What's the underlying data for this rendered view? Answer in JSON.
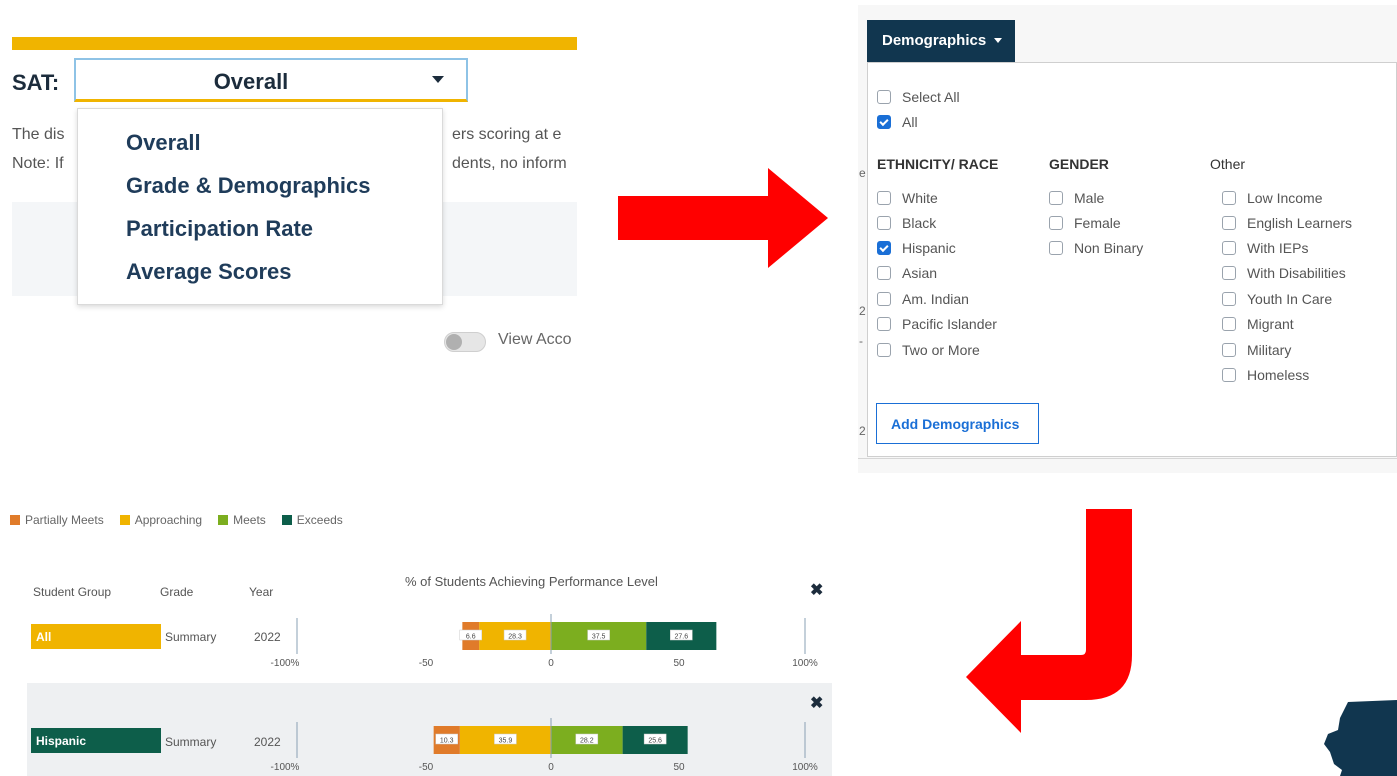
{
  "sat": {
    "label": "SAT:",
    "selected": "Overall",
    "description_start": "The dis",
    "description_end": "ers scoring at e",
    "note_start": "Note: If",
    "note_end": "dents, no inform",
    "menu_items": [
      "Overall",
      "Grade & Demographics",
      "Participation Rate",
      "Average Scores"
    ],
    "toggle_label": "View Acco"
  },
  "demographics": {
    "button_label": "Demographics",
    "select_all": {
      "label": "Select All",
      "checked": false
    },
    "all": {
      "label": "All",
      "checked": true
    },
    "columns": [
      {
        "heading": "ETHNICITY/ RACE",
        "items": [
          {
            "label": "White",
            "checked": false
          },
          {
            "label": "Black",
            "checked": false
          },
          {
            "label": "Hispanic",
            "checked": true
          },
          {
            "label": "Asian",
            "checked": false
          },
          {
            "label": "Am. Indian",
            "checked": false
          },
          {
            "label": "Pacific Islander",
            "checked": false
          },
          {
            "label": "Two or More",
            "checked": false
          }
        ]
      },
      {
        "heading": "GENDER",
        "items": [
          {
            "label": "Male",
            "checked": false
          },
          {
            "label": "Female",
            "checked": false
          },
          {
            "label": "Non Binary",
            "checked": false
          }
        ]
      },
      {
        "heading": "Other",
        "items": [
          {
            "label": "Low Income",
            "checked": false
          },
          {
            "label": "English Learners",
            "checked": false
          },
          {
            "label": "With IEPs",
            "checked": false
          },
          {
            "label": "With Disabilities",
            "checked": false
          },
          {
            "label": "Youth In Care",
            "checked": false
          },
          {
            "label": "Migrant",
            "checked": false
          },
          {
            "label": "Military",
            "checked": false
          },
          {
            "label": "Homeless",
            "checked": false
          }
        ]
      }
    ],
    "add_button": "Add Demographics",
    "peek": [
      "e",
      "2",
      "2",
      "-"
    ]
  },
  "chart": {
    "legend": [
      {
        "label": "Partially Meets",
        "color": "#e07b2a"
      },
      {
        "label": "Approaching",
        "color": "#f0b400"
      },
      {
        "label": "Meets",
        "color": "#7cae1f"
      },
      {
        "label": "Exceeds",
        "color": "#0d5e4a"
      }
    ],
    "headers": {
      "student_group": "Student Group",
      "grade": "Grade",
      "year": "Year",
      "title": "% of Students Achieving Performance Level"
    },
    "axis_ticks": [
      "-100%",
      "-50",
      "0",
      "50",
      "100%"
    ],
    "close_symbol": "✖",
    "rows": [
      {
        "group": "All",
        "group_color": "#f0b400",
        "group_text_color": "#ffffff",
        "grade": "Summary",
        "year": "2022"
      },
      {
        "group": "Hispanic",
        "group_color": "#0d5e4a",
        "group_text_color": "#ffffff",
        "grade": "Summary",
        "year": "2022"
      }
    ]
  },
  "chart_data": {
    "type": "bar",
    "title": "% of Students Achieving Performance Level",
    "xlim": [
      -100,
      100
    ],
    "categories": [
      "All",
      "Hispanic"
    ],
    "series": [
      {
        "name": "Partially Meets",
        "color": "#e07b2a",
        "values": [
          6.6,
          10.3
        ]
      },
      {
        "name": "Approaching",
        "color": "#f0b400",
        "values": [
          28.3,
          35.9
        ]
      },
      {
        "name": "Meets",
        "color": "#7cae1f",
        "values": [
          37.5,
          28.2
        ]
      },
      {
        "name": "Exceeds",
        "color": "#0d5e4a",
        "values": [
          27.6,
          25.6
        ]
      }
    ]
  }
}
